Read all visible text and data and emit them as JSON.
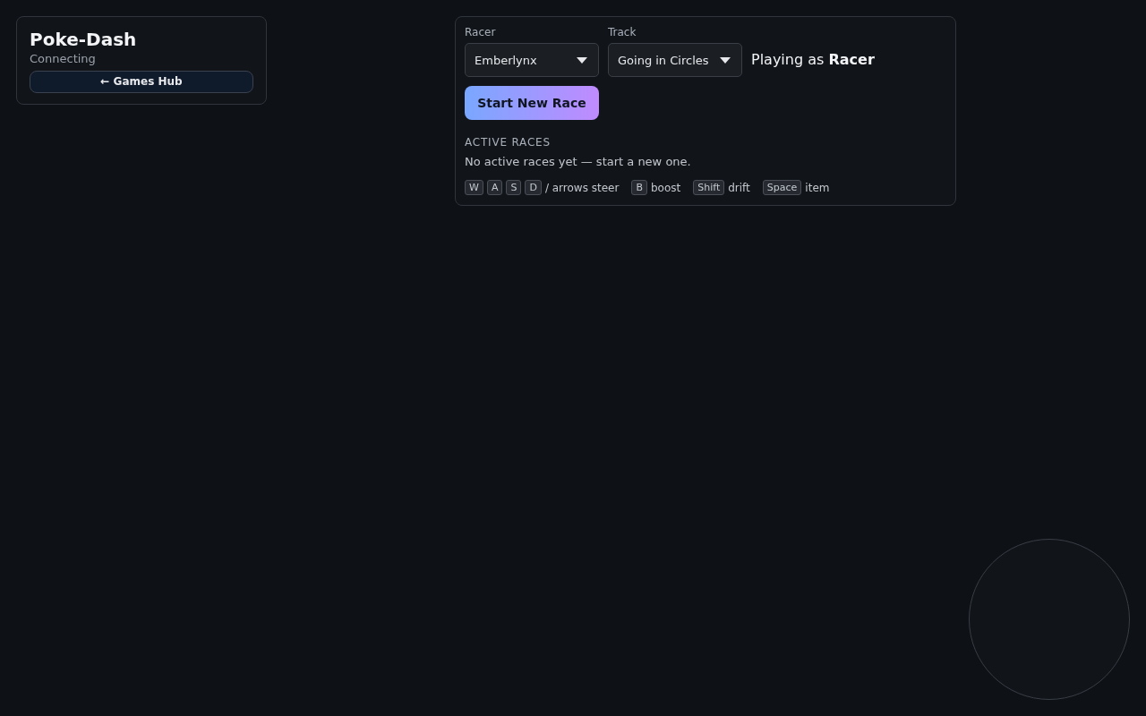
{
  "header": {
    "title": "Poke-Dash",
    "status": "Connecting",
    "hub_link": "← Games Hub"
  },
  "setup": {
    "racer": {
      "label": "Racer",
      "value": "Emberlynx"
    },
    "track": {
      "label": "Track",
      "value": "Going in Circles"
    },
    "playing_as": "Playing as **Racer**",
    "start_button": "Start New Race"
  },
  "active_races": {
    "heading": "ACTIVE RACES",
    "empty_message": "No active races yet — start a new one."
  },
  "controls": [
    {
      "keys": [
        "W",
        "A",
        "S",
        "D"
      ],
      "label": "/ arrows steer"
    },
    {
      "keys": [
        "B"
      ],
      "label": "boost"
    },
    {
      "keys": [
        "Shift"
      ],
      "label": "drift"
    },
    {
      "keys": [
        "Space"
      ],
      "label": "item"
    }
  ]
}
